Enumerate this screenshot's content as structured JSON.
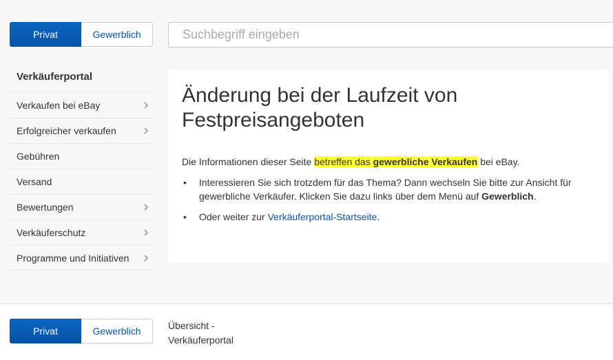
{
  "segment": {
    "private_label": "Privat",
    "business_label": "Gewerblich"
  },
  "search": {
    "placeholder": "Suchbegriff eingeben"
  },
  "sidebar": {
    "title": "Verkäuferportal",
    "items": [
      {
        "label": "Verkaufen bei eBay",
        "has_chevron": true
      },
      {
        "label": "Erfolgreicher verkaufen",
        "has_chevron": true
      },
      {
        "label": "Gebühren",
        "has_chevron": false
      },
      {
        "label": "Versand",
        "has_chevron": false
      },
      {
        "label": "Bewertungen",
        "has_chevron": true
      },
      {
        "label": "Verkäuferschutz",
        "has_chevron": true
      },
      {
        "label": "Programme und Initiativen",
        "has_chevron": true
      }
    ]
  },
  "main": {
    "title": "Änderung bei der Laufzeit von Festpreisangeboten",
    "intro_prefix": "Die Informationen dieser Seite ",
    "intro_highlight_normal": "betreffen das ",
    "intro_highlight_bold": "gewerbliche Verkaufen",
    "intro_suffix": " bei eBay.",
    "bullet1_prefix": "Interessieren Sie sich trotzdem für das Thema? Dann wechseln Sie bitte zur Ansicht für gewerbliche Verkäufer. Klicken Sie dazu links über dem Menü auf ",
    "bullet1_bold": "Gewerblich",
    "bullet1_suffix": ".",
    "bullet2_prefix": "Oder weiter zur ",
    "bullet2_link": "Verkäuferportal-Startseite",
    "bullet2_suffix": "."
  },
  "footer": {
    "breadcrumb": "Übersicht - Verkäuferportal"
  },
  "colors": {
    "accent": "#0654ba",
    "highlight": "#ffff33"
  }
}
